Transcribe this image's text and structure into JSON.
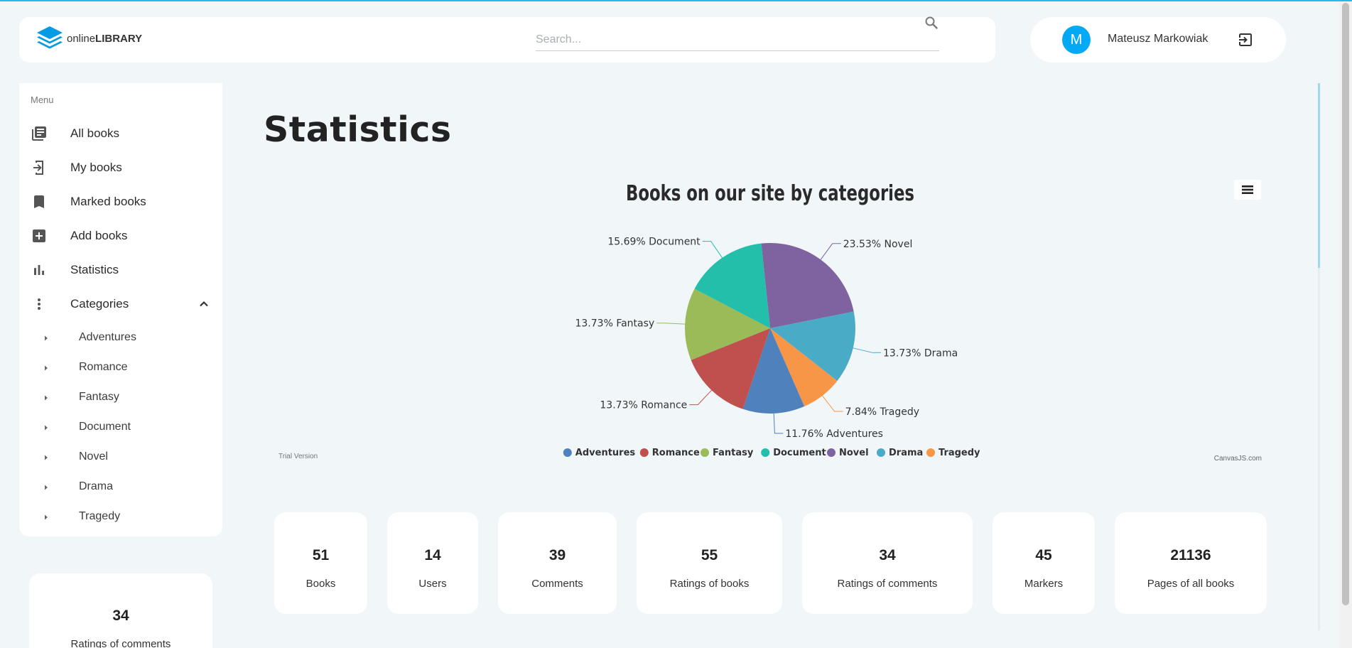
{
  "header": {
    "logo_prefix": "online",
    "logo_bold": "LIBRARY",
    "search_placeholder": "Search...",
    "user_initial": "M",
    "user_name": "Mateusz Markowiak"
  },
  "sidebar": {
    "menu_label": "Menu",
    "items": [
      {
        "label": "All books",
        "icon": "library-books-icon"
      },
      {
        "label": "My books",
        "icon": "book-open-icon"
      },
      {
        "label": "Marked books",
        "icon": "bookmark-icon"
      },
      {
        "label": "Add books",
        "icon": "add-box-icon"
      },
      {
        "label": "Statistics",
        "icon": "bar-chart-icon"
      },
      {
        "label": "Categories",
        "icon": "more-vertical-icon"
      }
    ],
    "categories": [
      "Adventures",
      "Romance",
      "Fantasy",
      "Document",
      "Novel",
      "Drama",
      "Tragedy"
    ],
    "side_card": {
      "value": "34",
      "caption": "Ratings of comments"
    }
  },
  "main": {
    "title": "Statistics"
  },
  "chart_data": {
    "type": "pie",
    "title": "Books on our site by categories",
    "slices": [
      {
        "name": "Novel",
        "percent": 23.53,
        "label": "23.53% Novel",
        "color": "#7f63a0"
      },
      {
        "name": "Drama",
        "percent": 13.73,
        "label": "13.73% Drama",
        "color": "#4aabc6"
      },
      {
        "name": "Tragedy",
        "percent": 7.84,
        "label": "7.84% Tragedy",
        "color": "#f79646"
      },
      {
        "name": "Adventures",
        "percent": 11.76,
        "label": "11.76% Adventures",
        "color": "#4f81bc"
      },
      {
        "name": "Romance",
        "percent": 13.73,
        "label": "13.73% Romance",
        "color": "#c0504e"
      },
      {
        "name": "Fantasy",
        "percent": 13.73,
        "label": "13.73% Fantasy",
        "color": "#9bbb58"
      },
      {
        "name": "Document",
        "percent": 15.69,
        "label": "15.69% Document",
        "color": "#23bfaa"
      }
    ],
    "legend": [
      "Adventures",
      "Romance",
      "Fantasy",
      "Document",
      "Novel",
      "Drama",
      "Tragedy"
    ],
    "legend_placement": "bottom",
    "trial_text": "Trial Version",
    "credit_text": "CanvasJS.com"
  },
  "stats": [
    {
      "value": "51",
      "caption": "Books"
    },
    {
      "value": "14",
      "caption": "Users"
    },
    {
      "value": "39",
      "caption": "Comments"
    },
    {
      "value": "55",
      "caption": "Ratings of books"
    },
    {
      "value": "34",
      "caption": "Ratings of comments"
    },
    {
      "value": "45",
      "caption": "Markers"
    },
    {
      "value": "21136",
      "caption": "Pages of all books"
    }
  ]
}
